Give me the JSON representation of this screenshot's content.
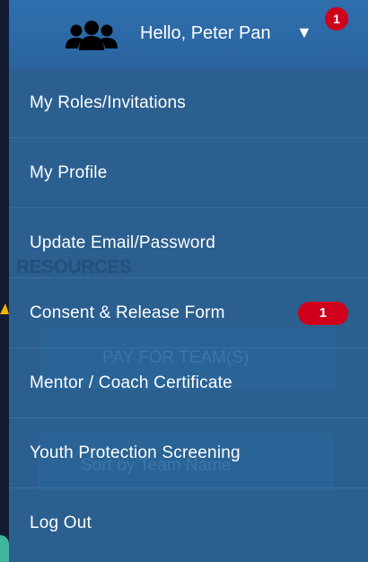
{
  "header": {
    "greeting": "Hello, Peter Pan",
    "caret": "▼",
    "notification_count": "1",
    "icon": "users-icon"
  },
  "menu": {
    "items": [
      {
        "label": "My Roles/Invitations"
      },
      {
        "label": "My Profile"
      },
      {
        "label": "Update Email/Password"
      },
      {
        "label": "Consent & Release Form",
        "badge": "1"
      },
      {
        "label": "Mentor / Coach Certificate"
      },
      {
        "label": "Youth Protection Screening"
      },
      {
        "label": "Log Out"
      }
    ]
  },
  "background": {
    "section_heading": "RESOURCES",
    "pay_button": "PAY FOR TEAM(S)",
    "sort_select": "Sort by Team Name"
  },
  "colors": {
    "header": "#2f6fae",
    "menu": "#2b5f8f",
    "badge": "#d0021b"
  }
}
